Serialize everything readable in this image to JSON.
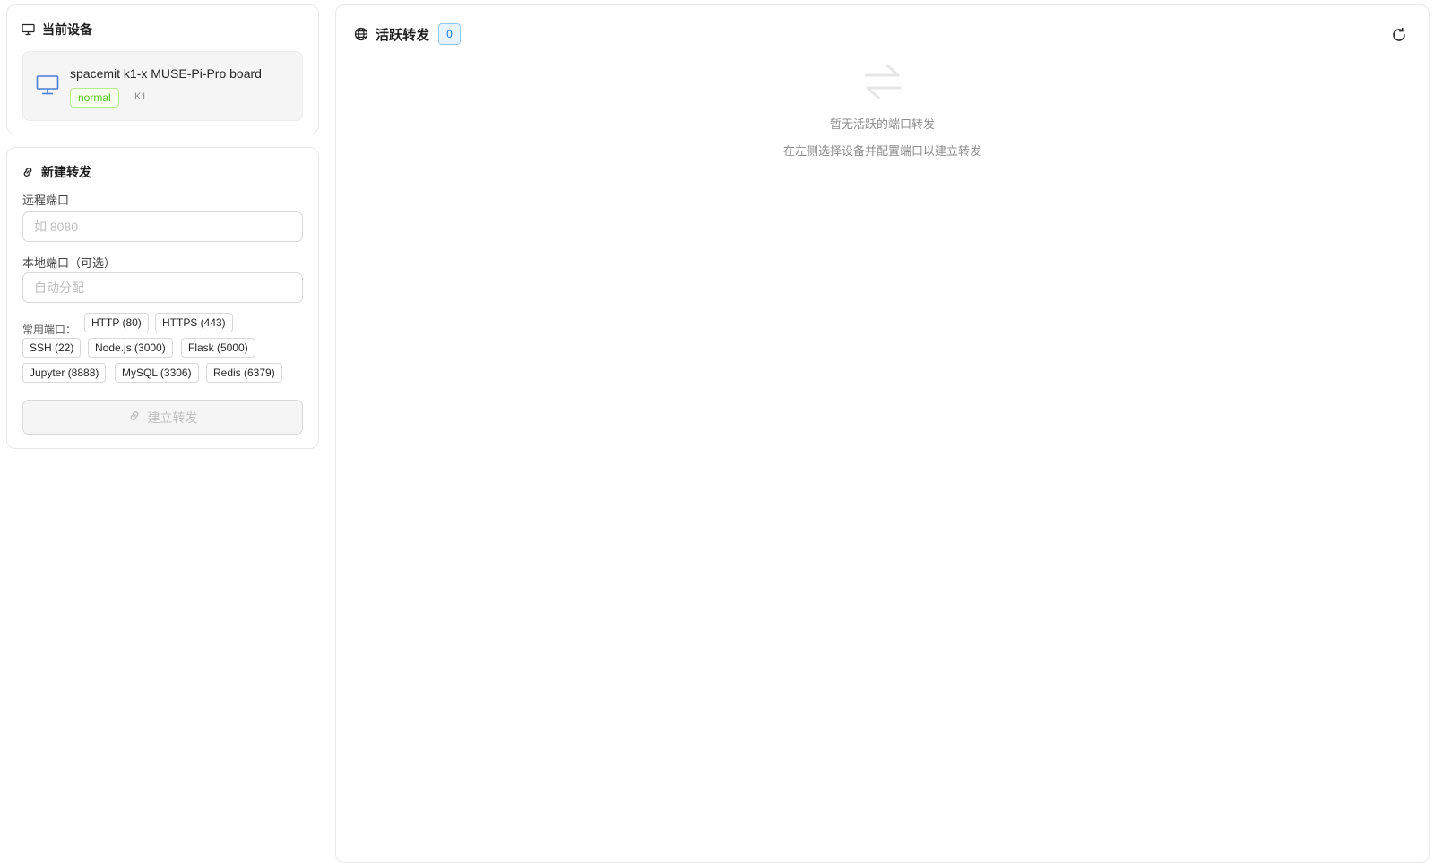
{
  "current_device": {
    "title": "当前设备",
    "title_icon": "monitor-icon",
    "device": {
      "name": "spacemit k1-x MUSE-Pi-Pro board",
      "status": "normal",
      "chip": "K1",
      "icon": "desktop-icon"
    }
  },
  "new_forward": {
    "title": "新建转发",
    "title_icon": "link-icon",
    "remote_port_label": "远程端口",
    "remote_port_placeholder": "如 8080",
    "remote_port_value": "",
    "local_port_label": "本地端口（可选）",
    "local_port_placeholder": "自动分配",
    "local_port_value": "",
    "presets_label": "常用端口：",
    "presets": [
      "HTTP (80)",
      "HTTPS (443)",
      "SSH (22)",
      "Node.js (3000)",
      "Flask (5000)",
      "Jupyter (8888)",
      "MySQL (3306)",
      "Redis (6379)"
    ],
    "create_button": "建立转发"
  },
  "active_forwards": {
    "title": "活跃转发",
    "title_icon": "globe-icon",
    "count": "0",
    "refresh_icon": "refresh-icon",
    "empty_icon": "swap-icon",
    "empty_title": "暂无活跃的端口转发",
    "empty_description": "在左侧选择设备并配置端口以建立转发"
  },
  "colors": {
    "status_green": "#52c41a",
    "accent_blue": "#1677ff",
    "device_icon_blue": "#4a7fd4"
  }
}
